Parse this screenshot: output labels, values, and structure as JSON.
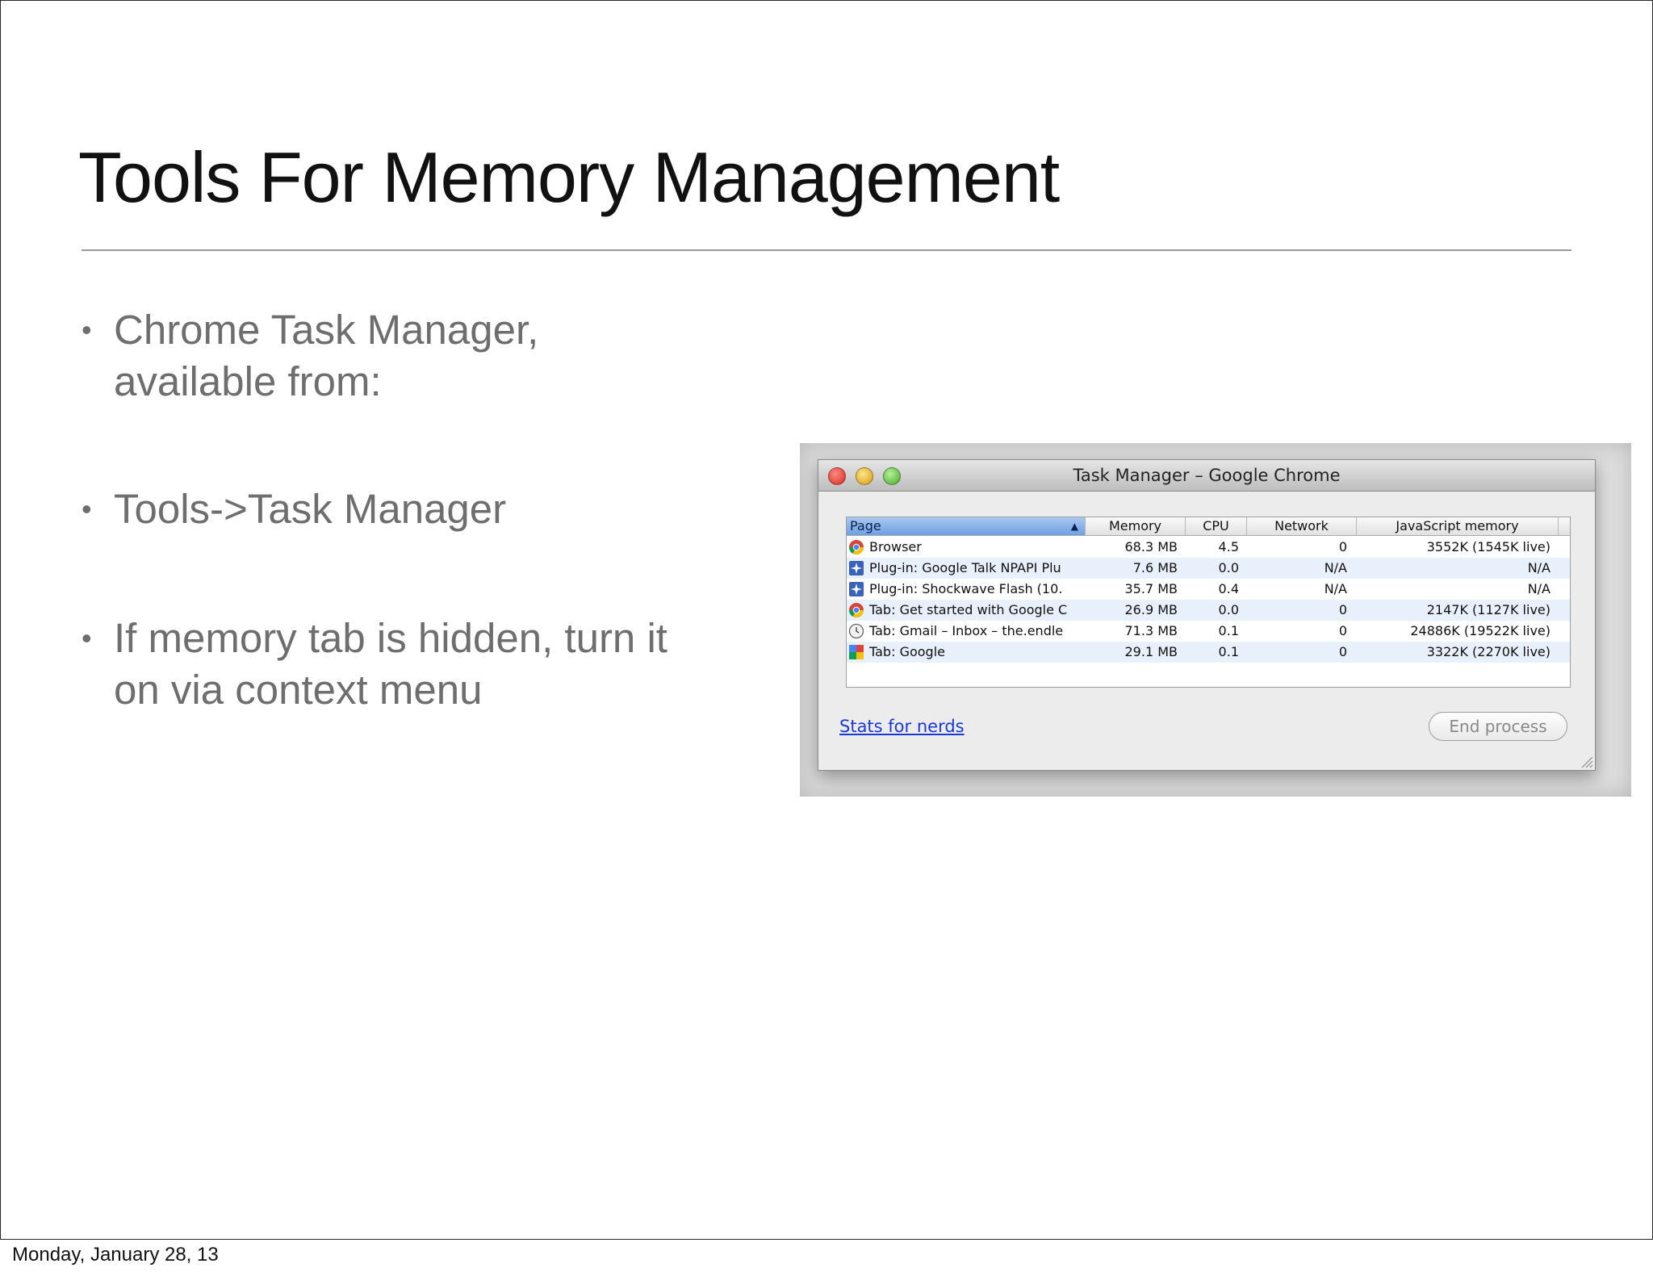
{
  "slide": {
    "title": "Tools For Memory Management",
    "bullets": [
      {
        "lines": [
          "Chrome Task Manager,",
          "available from:"
        ]
      },
      {
        "lines": [
          "Tools->Task Manager"
        ]
      },
      {
        "lines": [
          "If memory tab is hidden, turn it",
          "on via context menu"
        ]
      }
    ],
    "footer": "Monday, January 28, 13"
  },
  "window": {
    "title": "Task Manager – Google Chrome",
    "columns": [
      "Page",
      "Memory",
      "CPU",
      "Network",
      "JavaScript memory"
    ],
    "sort_indicator": "▲",
    "rows": [
      {
        "icon": "chrome-icon",
        "page": "Browser",
        "memory": "68.3 MB",
        "cpu": "4.5",
        "network": "0",
        "js": "3552K (1545K live)"
      },
      {
        "icon": "plugin-icon",
        "page": "Plug-in: Google Talk NPAPI Plu",
        "memory": "7.6 MB",
        "cpu": "0.0",
        "network": "N/A",
        "js": "N/A"
      },
      {
        "icon": "plugin-icon",
        "page": "Plug-in: Shockwave Flash (10.",
        "memory": "35.7 MB",
        "cpu": "0.4",
        "network": "N/A",
        "js": "N/A"
      },
      {
        "icon": "chrome-icon",
        "page": "Tab: Get started with Google C",
        "memory": "26.9 MB",
        "cpu": "0.0",
        "network": "0",
        "js": "2147K (1127K live)"
      },
      {
        "icon": "clock-icon",
        "page": "Tab: Gmail – Inbox – the.endle",
        "memory": "71.3 MB",
        "cpu": "0.1",
        "network": "0",
        "js": "24886K (19522K live)"
      },
      {
        "icon": "google-icon",
        "page": "Tab: Google",
        "memory": "29.1 MB",
        "cpu": "0.1",
        "network": "0",
        "js": "3322K (2270K live)"
      }
    ],
    "stats_link": "Stats for nerds",
    "end_process": "End process"
  }
}
